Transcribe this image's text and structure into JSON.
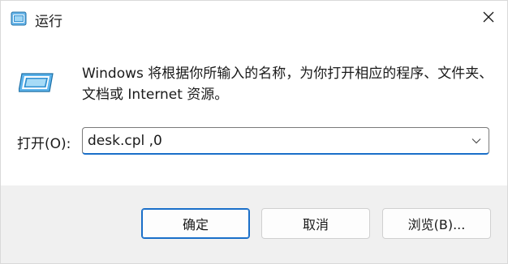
{
  "window": {
    "title": "运行",
    "icon": "run-icon",
    "close_icon": "close-icon"
  },
  "description": "Windows 将根据你所输入的名称，为你打开相应的程序、文件夹、文档或 Internet 资源。",
  "open_field": {
    "label": "打开(O):",
    "value": "desk.cpl ,0",
    "dropdown_icon": "chevron-down-icon"
  },
  "buttons": {
    "ok": "确定",
    "cancel": "取消",
    "browse": "浏览(B)..."
  },
  "colors": {
    "accent": "#1a6fc9",
    "footer_bg": "#f0f0f0",
    "content_bg": "#ffffff"
  }
}
